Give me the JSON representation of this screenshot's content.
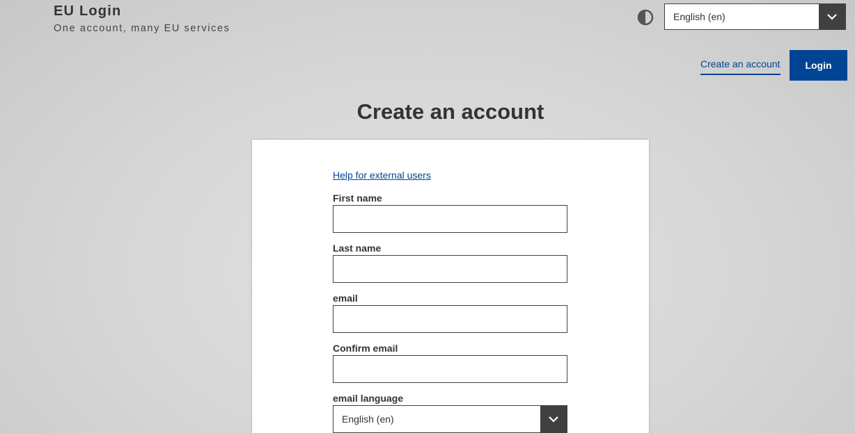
{
  "header": {
    "brand_title": "EU Login",
    "brand_subtitle": "One account, many EU services",
    "contrast_icon": "contrast-icon",
    "language_selected": "English (en)",
    "create_account_label": "Create an account",
    "login_label": "Login"
  },
  "main": {
    "page_title": "Create an account",
    "help_link": "Help for external users",
    "form": {
      "first_name_label": "First name",
      "first_name_value": "",
      "last_name_label": "Last name",
      "last_name_value": "",
      "email_label": "email",
      "email_value": "",
      "confirm_email_label": "Confirm email",
      "confirm_email_value": "",
      "email_language_label": "email language",
      "email_language_selected": "English (en)"
    }
  },
  "colors": {
    "brand_blue": "#004494",
    "dark_gray": "#404040",
    "text": "#333333"
  }
}
